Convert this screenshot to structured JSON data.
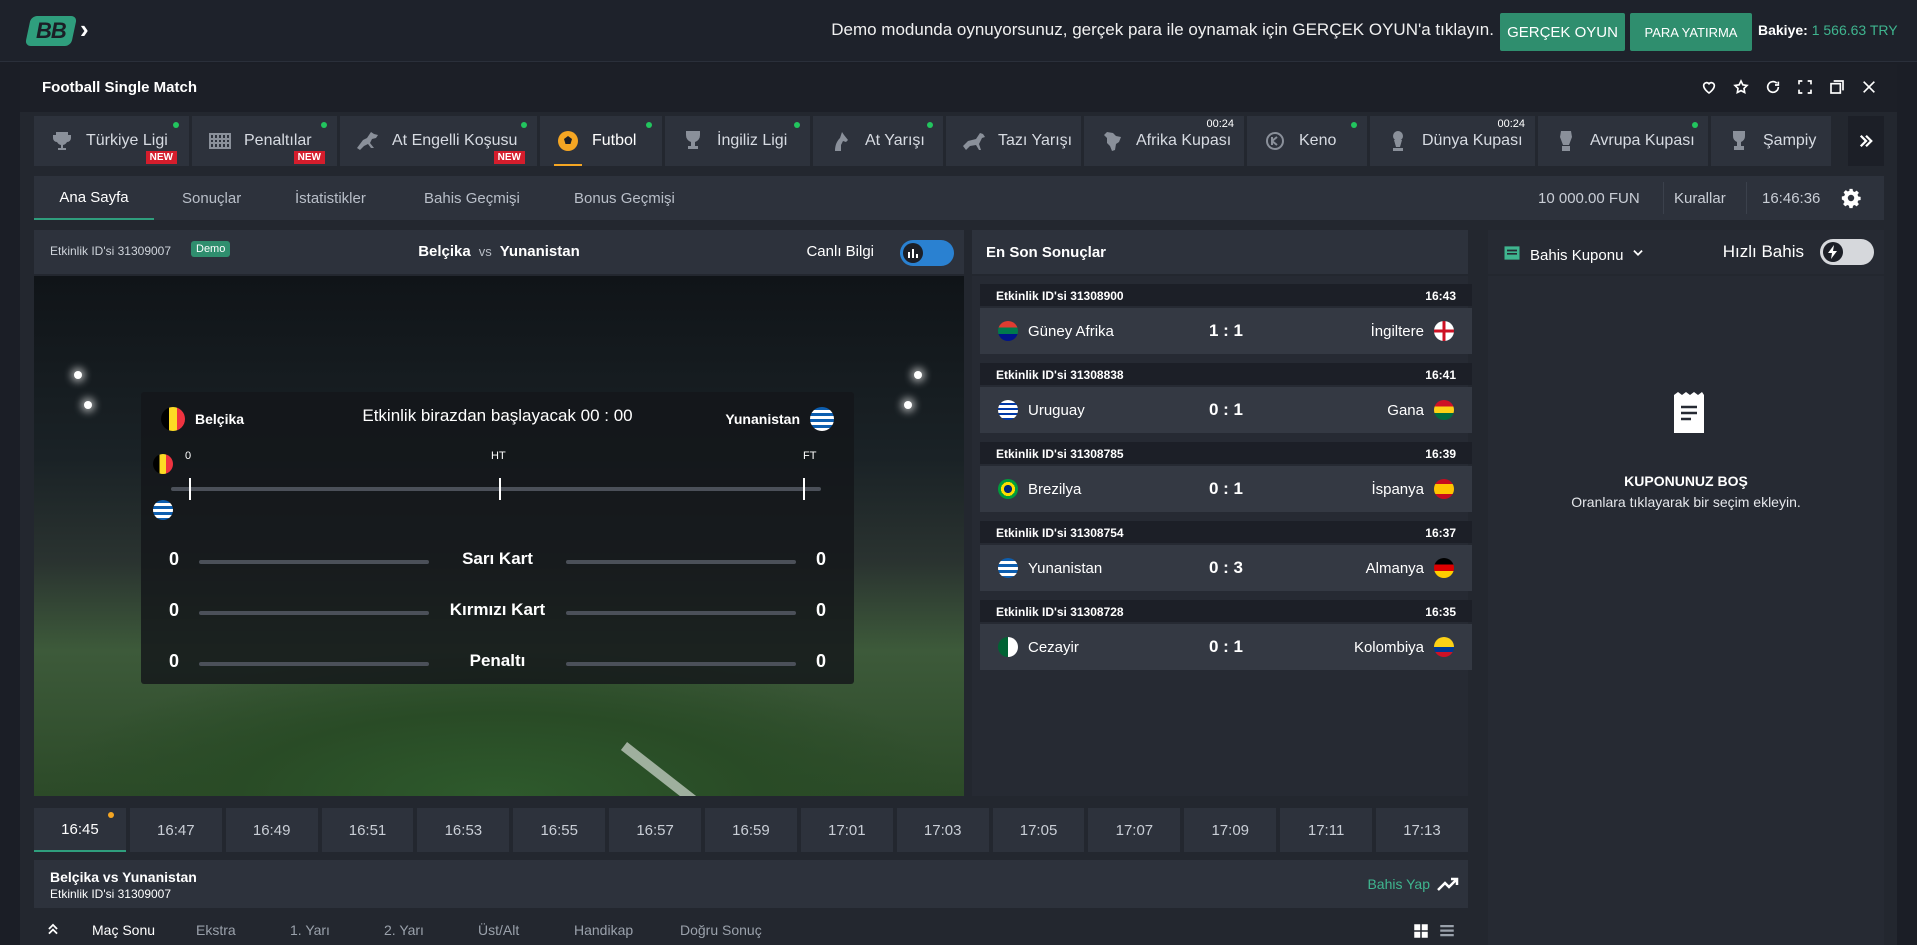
{
  "topbar": {
    "logo": "BB",
    "demo_message": "Demo modunda oynuyorsunuz, gerçek para ile oynamak için GERÇEK OYUN'a tıklayın.",
    "real_game_button": "GERÇEK OYUN",
    "deposit_button": "PARA YATIRMA",
    "balance_label": "Bakiye:",
    "balance_value": "1 566.63 TRY"
  },
  "window": {
    "title": "Football Single Match"
  },
  "game_tabs": [
    {
      "label": "Türkiye Ligi",
      "icon": "trophy-icon",
      "new": "NEW"
    },
    {
      "label": "Penaltılar",
      "icon": "goal-net-icon",
      "new": "NEW"
    },
    {
      "label": "At Engelli Koşusu",
      "icon": "horse-jump-icon",
      "new": "NEW"
    },
    {
      "label": "Futbol",
      "icon": "football-icon"
    },
    {
      "label": "İngiliz Ligi",
      "icon": "cup-icon"
    },
    {
      "label": "At Yarışı",
      "icon": "horse-head-icon"
    },
    {
      "label": "Tazı Yarışı",
      "icon": "greyhound-icon"
    },
    {
      "label": "Afrika Kupası",
      "icon": "africa-icon",
      "time": "00:24"
    },
    {
      "label": "Keno",
      "icon": "keno-icon"
    },
    {
      "label": "Dünya Kupası",
      "icon": "world-cup-icon",
      "time": "00:24"
    },
    {
      "label": "Avrupa Kupası",
      "icon": "euro-cup-icon"
    },
    {
      "label": "Şampiy",
      "icon": "champions-icon"
    }
  ],
  "nav": {
    "tabs": [
      "Ana Sayfa",
      "Sonuçlar",
      "İstatistikler",
      "Bahis Geçmişi",
      "Bonus Geçmişi"
    ],
    "fun_balance": "10 000.00 FUN",
    "rules": "Kurallar",
    "clock": "16:46:36"
  },
  "event": {
    "id_text": "Etkinlik ID'si 31309007",
    "badge": "Demo",
    "home": "Belçika",
    "vs": "vs",
    "away": "Yunanistan",
    "live_info": "Canlı Bilgi",
    "status_msg": "Etkinlik birazdan başlayacak 00 : 00",
    "timeline_labels": [
      "0",
      "HT",
      "FT"
    ],
    "stats": [
      {
        "name": "Sarı Kart",
        "home": "0",
        "away": "0"
      },
      {
        "name": "Kırmızı Kart",
        "home": "0",
        "away": "0"
      },
      {
        "name": "Penaltı",
        "home": "0",
        "away": "0"
      }
    ]
  },
  "results": {
    "title": "En Son Sonuçlar",
    "items": [
      {
        "id": "Etkinlik ID'si 31308900",
        "time": "16:43",
        "home": "Güney Afrika",
        "score": "1 : 1",
        "away": "İngiltere"
      },
      {
        "id": "Etkinlik ID'si 31308838",
        "time": "16:41",
        "home": "Uruguay",
        "score": "0 : 1",
        "away": "Gana"
      },
      {
        "id": "Etkinlik ID'si 31308785",
        "time": "16:39",
        "home": "Brezilya",
        "score": "0 : 1",
        "away": "İspanya"
      },
      {
        "id": "Etkinlik ID'si 31308754",
        "time": "16:37",
        "home": "Yunanistan",
        "score": "0 : 3",
        "away": "Almanya"
      },
      {
        "id": "Etkinlik ID'si 31308728",
        "time": "16:35",
        "home": "Cezayir",
        "score": "0 : 1",
        "away": "Kolombiya"
      }
    ]
  },
  "coupon": {
    "title": "Bahis Kuponu",
    "quick_bet": "Hızlı Bahis",
    "empty_title": "KUPONUNUZ BOŞ",
    "empty_sub": "Oranlara tıklayarak bir seçim ekleyin."
  },
  "timeslots": [
    "16:45",
    "16:47",
    "16:49",
    "16:51",
    "16:53",
    "16:55",
    "16:57",
    "16:59",
    "17:01",
    "17:03",
    "17:05",
    "17:07",
    "17:09",
    "17:11",
    "17:13"
  ],
  "match": {
    "title": "Belçika vs Yunanistan",
    "id_text": "Etkinlik ID'si 31309007",
    "bet_link": "Bahis Yap",
    "tabs": [
      "Maç Sonu",
      "Ekstra",
      "1. Yarı",
      "2. Yarı",
      "Üst/Alt",
      "Handikap",
      "Doğru Sonuç"
    ]
  },
  "colors": {
    "accent": "#2f8e6e",
    "new_badge": "#d51d2c",
    "live_dot": "#22c55e",
    "toggle_blue": "#2a81d1"
  }
}
